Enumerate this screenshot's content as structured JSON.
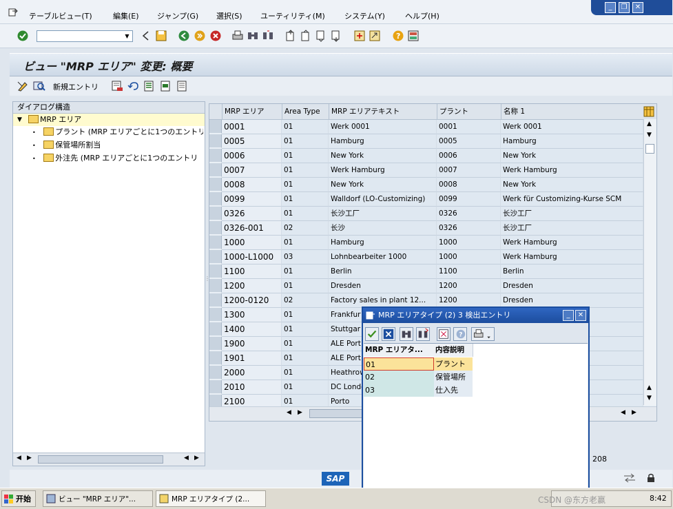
{
  "menu": [
    "テーブルビュー(T)",
    "編集(E)",
    "ジャンプ(G)",
    "選択(S)",
    "ユーティリティ(M)",
    "システム(Y)",
    "ヘルプ(H)"
  ],
  "screen_title": "ビュー \"MRP エリア\" 変更: 概要",
  "app_toolbar": {
    "new_entries": "新規エントリ"
  },
  "tree": {
    "header": "ダイアログ構造",
    "root": "MRP エリア",
    "children": [
      "プラント (MRP エリアごとに1つのエントリ",
      "保管場所割当",
      "外注先 (MRP エリアごとに1つのエントリ"
    ]
  },
  "table": {
    "columns": [
      "MRP エリア",
      "Area Type",
      "MRP エリアテキスト",
      "プラント",
      "名称 1"
    ],
    "rows": [
      {
        "area": "0001",
        "type": "01",
        "text": "Werk 0001",
        "plant": "0001",
        "name": "Werk 0001"
      },
      {
        "area": "0005",
        "type": "01",
        "text": "Hamburg",
        "plant": "0005",
        "name": "Hamburg"
      },
      {
        "area": "0006",
        "type": "01",
        "text": "New York",
        "plant": "0006",
        "name": "New York"
      },
      {
        "area": "0007",
        "type": "01",
        "text": "Werk Hamburg",
        "plant": "0007",
        "name": "Werk Hamburg"
      },
      {
        "area": "0008",
        "type": "01",
        "text": "New York",
        "plant": "0008",
        "name": "New York"
      },
      {
        "area": "0099",
        "type": "01",
        "text": "Walldorf (LO-Customizing)",
        "plant": "0099",
        "name": "Werk für Customizing-Kurse SCM"
      },
      {
        "area": "0326",
        "type": "01",
        "text": "长沙工厂",
        "plant": "0326",
        "name": "长沙工厂"
      },
      {
        "area": "0326-001",
        "type": "02",
        "text": "长沙",
        "plant": "0326",
        "name": "长沙工厂"
      },
      {
        "area": "1000",
        "type": "01",
        "text": "Hamburg",
        "plant": "1000",
        "name": "Werk Hamburg"
      },
      {
        "area": "1000-L1000",
        "type": "03",
        "text": "Lohnbearbeiter 1000",
        "plant": "1000",
        "name": "Werk Hamburg"
      },
      {
        "area": "1100",
        "type": "01",
        "text": "Berlin",
        "plant": "1100",
        "name": "Berlin"
      },
      {
        "area": "1200",
        "type": "01",
        "text": "Dresden",
        "plant": "1200",
        "name": "Dresden"
      },
      {
        "area": "1200-0120",
        "type": "02",
        "text": "Factory sales in plant 12...",
        "plant": "1200",
        "name": "Dresden"
      },
      {
        "area": "1300",
        "type": "01",
        "text": "Frankfur",
        "plant": "",
        "name": ""
      },
      {
        "area": "1400",
        "type": "01",
        "text": "Stuttgar",
        "plant": "",
        "name": ""
      },
      {
        "area": "1900",
        "type": "01",
        "text": "ALE Port",
        "plant": "",
        "name": ""
      },
      {
        "area": "1901",
        "type": "01",
        "text": "ALE Port",
        "plant": "",
        "name": ""
      },
      {
        "area": "2000",
        "type": "01",
        "text": "Heathrow",
        "plant": "",
        "name": ""
      },
      {
        "area": "2010",
        "type": "01",
        "text": "DC Londo",
        "plant": "",
        "name": ""
      },
      {
        "area": "2100",
        "type": "01",
        "text": "Porto",
        "plant": "",
        "name": ""
      }
    ]
  },
  "popup": {
    "title": "MRP エリアタイプ (2)   3 検出エントリ",
    "columns": [
      "MRP エリアタ...",
      "内容説明"
    ],
    "rows": [
      {
        "code": "01",
        "desc": "プラント"
      },
      {
        "code": "02",
        "desc": "保管場所"
      },
      {
        "code": "03",
        "desc": "仕入先"
      }
    ]
  },
  "status": {
    "count": "208",
    "sap": "SAP"
  },
  "taskbar": {
    "start": "开始",
    "tasks": [
      "ビュー \"MRP エリア\"...",
      "MRP エリアタイプ (2..."
    ],
    "time": "8:42",
    "watermark": "CSDN @东方老赢"
  },
  "colors": {
    "popup_title": "#1c4d9e",
    "tree_selected": "#fffbcf",
    "popup_selected": "#fbe39a"
  }
}
